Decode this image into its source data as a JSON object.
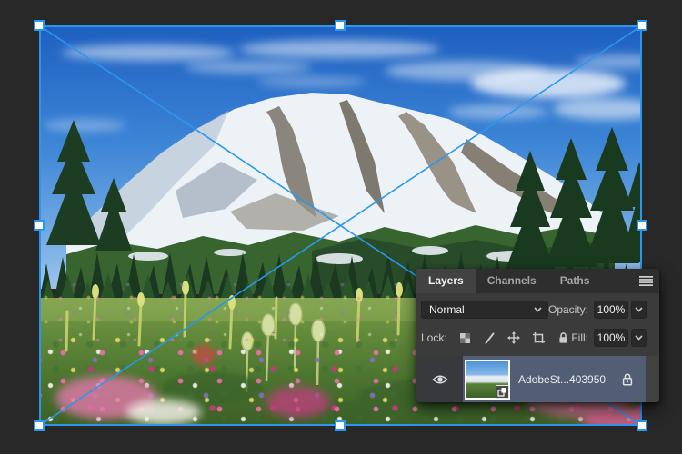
{
  "colors": {
    "accent_blue": "#2a97ec",
    "selected_row": "#515e74",
    "panel_bg": "#3b3b3b",
    "canvas_bg": "#282828",
    "field_bg": "#292929"
  },
  "canvas": {
    "mode": "free-transform-placed-smart-object",
    "handle_count": 8,
    "image": "mount-rainier-wildflower-meadow-photo"
  },
  "panel": {
    "tabs": [
      {
        "label": "Layers",
        "active": true
      },
      {
        "label": "Channels",
        "active": false
      },
      {
        "label": "Paths",
        "active": false
      }
    ],
    "blend_mode": {
      "value": "Normal"
    },
    "opacity": {
      "label": "Opacity:",
      "value": "100%"
    },
    "lock": {
      "label": "Lock:",
      "buttons": [
        "lock-transparency",
        "lock-pixels",
        "lock-position",
        "lock-artboard",
        "lock-all"
      ]
    },
    "fill": {
      "label": "Fill:",
      "value": "100%"
    },
    "layers": [
      {
        "name": "AdobeSt...403950",
        "visible": true,
        "locked": true,
        "selected": true,
        "smart_object": true
      }
    ]
  }
}
